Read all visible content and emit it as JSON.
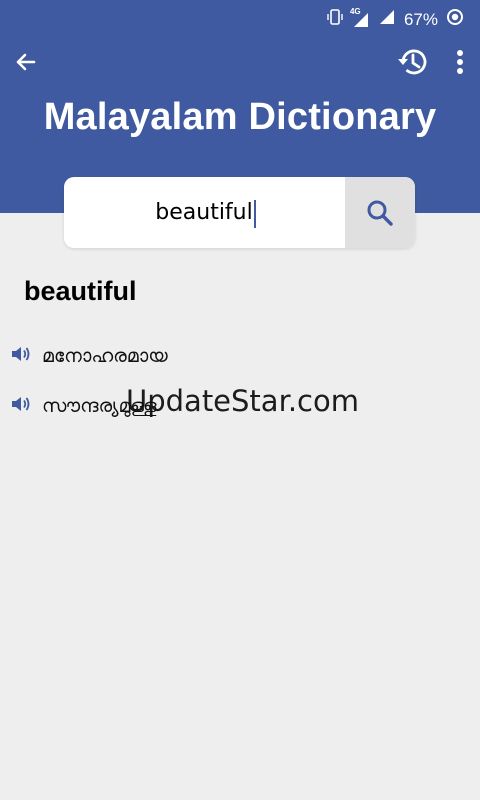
{
  "status": {
    "battery_percent": "67%",
    "network_label": "4G"
  },
  "header": {
    "title": "Malayalam Dictionary",
    "color": "#3f5aa0"
  },
  "search": {
    "value": "beautiful",
    "placeholder": ""
  },
  "result": {
    "word": "beautiful",
    "meanings": [
      {
        "text": "മനോഹരമായ"
      },
      {
        "text": "സൗന്ദര്യമുള്ള"
      }
    ]
  },
  "watermark": "UpdateStar.com"
}
